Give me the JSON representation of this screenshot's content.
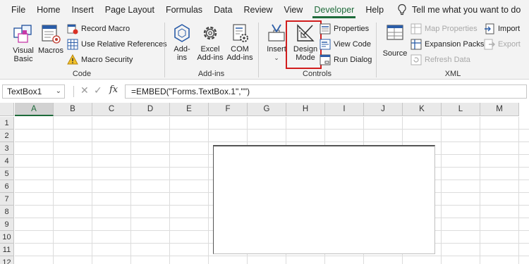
{
  "tabs": [
    "File",
    "Home",
    "Insert",
    "Page Layout",
    "Formulas",
    "Data",
    "Review",
    "View",
    "Developer",
    "Help"
  ],
  "active_tab": "Developer",
  "tell_me": "Tell me what you want to do",
  "ribbon": {
    "code": {
      "label": "Code",
      "visual_basic": [
        "Visual",
        "Basic"
      ],
      "macros": "Macros",
      "record_macro": "Record Macro",
      "use_relative": "Use Relative References",
      "macro_security": "Macro Security"
    },
    "addins": {
      "label": "Add-ins",
      "addins": [
        "Add-",
        "ins"
      ],
      "excel_addins": [
        "Excel",
        "Add-ins"
      ],
      "com_addins": [
        "COM",
        "Add-ins"
      ]
    },
    "controls": {
      "label": "Controls",
      "insert": "Insert",
      "design_mode": [
        "Design",
        "Mode"
      ],
      "properties": "Properties",
      "view_code": "View Code",
      "run_dialog": "Run Dialog"
    },
    "xml": {
      "label": "XML",
      "source": "Source",
      "map_properties": "Map Properties",
      "expansion_packs": "Expansion Packs",
      "refresh_data": "Refresh Data",
      "import": "Import",
      "export": "Export"
    }
  },
  "formula_bar": {
    "name_box": "TextBox1",
    "fx": "fx",
    "formula": "=EMBED(\"Forms.TextBox.1\",\"\")"
  },
  "columns": [
    "A",
    "B",
    "C",
    "D",
    "E",
    "F",
    "G",
    "H",
    "I",
    "J",
    "K",
    "L",
    "M"
  ],
  "selected_column": "A",
  "rows": [
    "1",
    "2",
    "3",
    "4",
    "5",
    "6",
    "7",
    "8",
    "9",
    "10",
    "11",
    "12"
  ],
  "colors": {
    "accent": "#1e6b3a",
    "highlight": "#d11d1d"
  }
}
